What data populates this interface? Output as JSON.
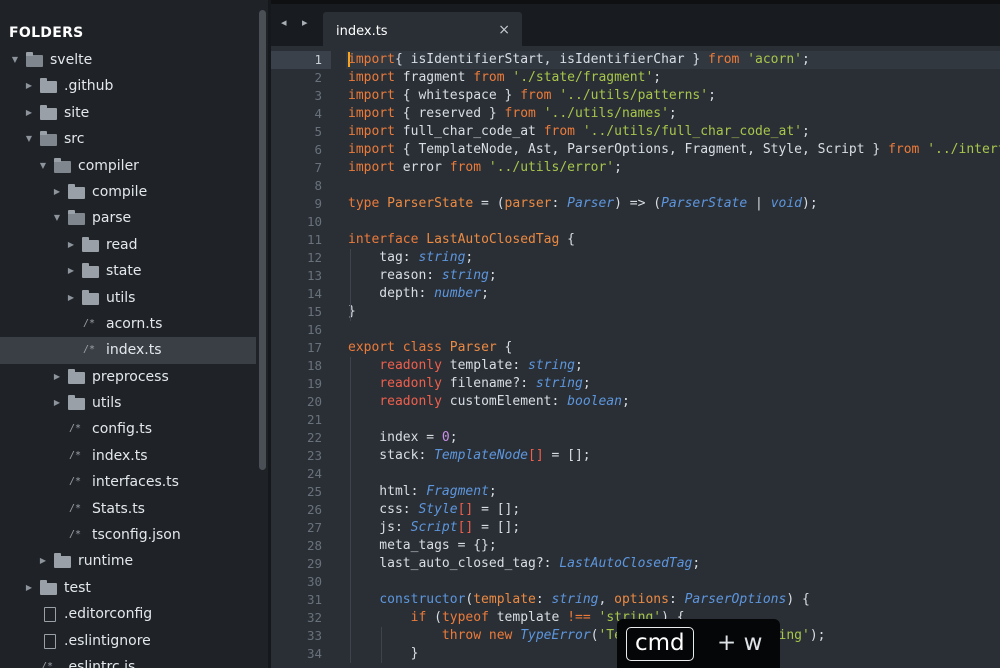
{
  "sidebar": {
    "title": "FOLDERS",
    "items": [
      {
        "label": "svelte",
        "kind": "folder",
        "depth": 0,
        "expanded": true
      },
      {
        "label": ".github",
        "kind": "folder",
        "depth": 1,
        "expanded": false
      },
      {
        "label": "site",
        "kind": "folder",
        "depth": 1,
        "expanded": false
      },
      {
        "label": "src",
        "kind": "folder",
        "depth": 1,
        "expanded": true
      },
      {
        "label": "compiler",
        "kind": "folder",
        "depth": 2,
        "expanded": true
      },
      {
        "label": "compile",
        "kind": "folder",
        "depth": 3,
        "expanded": false
      },
      {
        "label": "parse",
        "kind": "folder",
        "depth": 3,
        "expanded": true
      },
      {
        "label": "read",
        "kind": "folder",
        "depth": 4,
        "expanded": false
      },
      {
        "label": "state",
        "kind": "folder",
        "depth": 4,
        "expanded": false
      },
      {
        "label": "utils",
        "kind": "folder",
        "depth": 4,
        "expanded": false
      },
      {
        "label": "acorn.ts",
        "kind": "file",
        "depth": 4
      },
      {
        "label": "index.ts",
        "kind": "file",
        "depth": 4,
        "selected": true
      },
      {
        "label": "preprocess",
        "kind": "folder",
        "depth": 3,
        "expanded": false
      },
      {
        "label": "utils",
        "kind": "folder",
        "depth": 3,
        "expanded": false
      },
      {
        "label": "config.ts",
        "kind": "file",
        "depth": 3
      },
      {
        "label": "index.ts",
        "kind": "file",
        "depth": 3
      },
      {
        "label": "interfaces.ts",
        "kind": "file",
        "depth": 3
      },
      {
        "label": "Stats.ts",
        "kind": "file",
        "depth": 3
      },
      {
        "label": "tsconfig.json",
        "kind": "file",
        "depth": 3
      },
      {
        "label": "runtime",
        "kind": "folder",
        "depth": 2,
        "expanded": false
      },
      {
        "label": "test",
        "kind": "folder",
        "depth": 1,
        "expanded": false
      },
      {
        "label": ".editorconfig",
        "kind": "doc",
        "depth": 1
      },
      {
        "label": ".eslintignore",
        "kind": "doc",
        "depth": 1
      },
      {
        "label": ".eslintrc.js",
        "kind": "file",
        "depth": 1
      }
    ]
  },
  "tabs": {
    "nav_glyph": "◂ ▸",
    "active": {
      "label": "index.ts",
      "close_glyph": "×"
    }
  },
  "editor": {
    "current_line": 1,
    "line_numbers": [
      "1",
      "2",
      "3",
      "4",
      "5",
      "6",
      "7",
      "8",
      "9",
      "10",
      "11",
      "12",
      "13",
      "14",
      "15",
      "16",
      "17",
      "18",
      "19",
      "20",
      "21",
      "22",
      "23",
      "24",
      "25",
      "26",
      "27",
      "28",
      "29",
      "30",
      "31",
      "32",
      "33",
      "34"
    ],
    "lines": [
      [
        [
          "kw",
          "import"
        ],
        [
          "",
          "{ isIdentifierStart, isIdentifierChar } "
        ],
        [
          "kw",
          "from"
        ],
        [
          "",
          " "
        ],
        [
          "str",
          "'acorn'"
        ],
        [
          "",
          ";"
        ]
      ],
      [
        [
          "kw",
          "import"
        ],
        [
          "",
          " fragment "
        ],
        [
          "kw",
          "from"
        ],
        [
          "",
          " "
        ],
        [
          "str",
          "'./state/fragment'"
        ],
        [
          "",
          ";"
        ]
      ],
      [
        [
          "kw",
          "import"
        ],
        [
          "",
          " { whitespace } "
        ],
        [
          "kw",
          "from"
        ],
        [
          "",
          " "
        ],
        [
          "str",
          "'../utils/patterns'"
        ],
        [
          "",
          ";"
        ]
      ],
      [
        [
          "kw",
          "import"
        ],
        [
          "",
          " { reserved } "
        ],
        [
          "kw",
          "from"
        ],
        [
          "",
          " "
        ],
        [
          "str",
          "'../utils/names'"
        ],
        [
          "",
          ";"
        ]
      ],
      [
        [
          "kw",
          "import"
        ],
        [
          "",
          " full_char_code_at "
        ],
        [
          "kw",
          "from"
        ],
        [
          "",
          " "
        ],
        [
          "str",
          "'../utils/full_char_code_at'"
        ],
        [
          "",
          ";"
        ]
      ],
      [
        [
          "kw",
          "import"
        ],
        [
          "",
          " { TemplateNode, Ast, ParserOptions, Fragment, Style, Script } "
        ],
        [
          "kw",
          "from"
        ],
        [
          "",
          " "
        ],
        [
          "str",
          "'../interfaces'"
        ],
        [
          "",
          ";"
        ]
      ],
      [
        [
          "kw",
          "import"
        ],
        [
          "",
          " error "
        ],
        [
          "kw",
          "from"
        ],
        [
          "",
          " "
        ],
        [
          "str",
          "'../utils/error'"
        ],
        [
          "",
          ";"
        ]
      ],
      [],
      [
        [
          "kw",
          "type"
        ],
        [
          "",
          " "
        ],
        [
          "ty2",
          "ParserState"
        ],
        [
          "",
          " = ("
        ],
        [
          "ty2",
          "parser"
        ],
        [
          "",
          ": "
        ],
        [
          "typ",
          "Parser"
        ],
        [
          "",
          ") => ("
        ],
        [
          "typ",
          "ParserState"
        ],
        [
          "",
          " | "
        ],
        [
          "typ",
          "void"
        ],
        [
          "",
          ");"
        ]
      ],
      [],
      [
        [
          "kw",
          "interface"
        ],
        [
          "",
          " "
        ],
        [
          "ty2",
          "LastAutoClosedTag"
        ],
        [
          "",
          " {"
        ]
      ],
      [
        [
          "",
          "    tag: "
        ],
        [
          "typ",
          "string"
        ],
        [
          "",
          ";"
        ]
      ],
      [
        [
          "",
          "    reason: "
        ],
        [
          "typ",
          "string"
        ],
        [
          "",
          ";"
        ]
      ],
      [
        [
          "",
          "    depth: "
        ],
        [
          "typ",
          "number"
        ],
        [
          "",
          ";"
        ]
      ],
      [
        [
          "",
          "}"
        ]
      ],
      [],
      [
        [
          "kw",
          "export"
        ],
        [
          "",
          " "
        ],
        [
          "kw",
          "class"
        ],
        [
          "",
          " "
        ],
        [
          "ty2",
          "Parser"
        ],
        [
          "",
          " {"
        ]
      ],
      [
        [
          "",
          "    "
        ],
        [
          "ro",
          "readonly"
        ],
        [
          "",
          " template: "
        ],
        [
          "typ",
          "string"
        ],
        [
          "",
          ";"
        ]
      ],
      [
        [
          "",
          "    "
        ],
        [
          "ro",
          "readonly"
        ],
        [
          "",
          " filename?: "
        ],
        [
          "typ",
          "string"
        ],
        [
          "",
          ";"
        ]
      ],
      [
        [
          "",
          "    "
        ],
        [
          "ro",
          "readonly"
        ],
        [
          "",
          " customElement: "
        ],
        [
          "typ",
          "boolean"
        ],
        [
          "",
          ";"
        ]
      ],
      [],
      [
        [
          "",
          "    index = "
        ],
        [
          "num",
          "0"
        ],
        [
          "",
          ";"
        ]
      ],
      [
        [
          "",
          "    stack: "
        ],
        [
          "typ",
          "TemplateNode"
        ],
        [
          "ro",
          "[]"
        ],
        [
          "",
          " = [];"
        ]
      ],
      [],
      [
        [
          "",
          "    html: "
        ],
        [
          "typ",
          "Fragment"
        ],
        [
          "",
          ";"
        ]
      ],
      [
        [
          "",
          "    css: "
        ],
        [
          "typ",
          "Style"
        ],
        [
          "ro",
          "[]"
        ],
        [
          "",
          " = [];"
        ]
      ],
      [
        [
          "",
          "    js: "
        ],
        [
          "typ",
          "Script"
        ],
        [
          "ro",
          "[]"
        ],
        [
          "",
          " = [];"
        ]
      ],
      [
        [
          "",
          "    meta_tags = {};"
        ]
      ],
      [
        [
          "",
          "    last_auto_closed_tag?: "
        ],
        [
          "typ",
          "LastAutoClosedTag"
        ],
        [
          "",
          ";"
        ]
      ],
      [],
      [
        [
          "",
          "    "
        ],
        [
          "fn",
          "constructor"
        ],
        [
          "",
          "("
        ],
        [
          "ty2",
          "template"
        ],
        [
          "",
          ": "
        ],
        [
          "typ",
          "string"
        ],
        [
          "",
          ", "
        ],
        [
          "ty2",
          "options"
        ],
        [
          "",
          ": "
        ],
        [
          "typ",
          "ParserOptions"
        ],
        [
          "",
          ") {"
        ]
      ],
      [
        [
          "",
          "        "
        ],
        [
          "kw",
          "if"
        ],
        [
          "",
          " ("
        ],
        [
          "kw",
          "typeof"
        ],
        [
          "",
          " template "
        ],
        [
          "kw",
          "!=="
        ],
        [
          "",
          " "
        ],
        [
          "str",
          "'string'"
        ],
        [
          "",
          ") {"
        ]
      ],
      [
        [
          "",
          "            "
        ],
        [
          "kw",
          "throw"
        ],
        [
          "",
          " "
        ],
        [
          "kw",
          "new"
        ],
        [
          "",
          " "
        ],
        [
          "typ",
          "TypeError"
        ],
        [
          "",
          "("
        ],
        [
          "str",
          "'Template must be a string'"
        ],
        [
          "",
          ");"
        ]
      ],
      [
        [
          "",
          "        }"
        ]
      ]
    ]
  },
  "shortcut": {
    "key": "cmd",
    "plus": "+ w"
  },
  "colors": {
    "keyword": "#ec7b3a",
    "string": "#a8c64b",
    "type": "#5d96dd",
    "readonly": "#f05f4c",
    "number": "#c98ee6",
    "caret": "#f5a623"
  }
}
